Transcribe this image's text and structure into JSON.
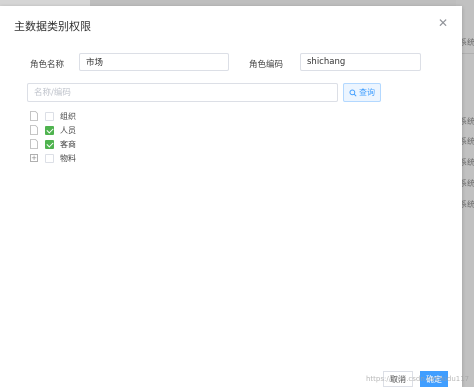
{
  "background": {
    "side_items": [
      "系统",
      "系统",
      "系统",
      "系统",
      "系统",
      "系统"
    ]
  },
  "dialog": {
    "title": "主数据类别权限",
    "close_icon": "close-icon"
  },
  "form": {
    "role_name_label": "角色名称",
    "role_name_value": "市场",
    "role_code_label": "角色编码",
    "role_code_value": "shichang"
  },
  "search": {
    "placeholder": "名称/编码",
    "button_label": "查询",
    "button_icon": "search-icon"
  },
  "tree": {
    "items": [
      {
        "label": "组织",
        "checked": false,
        "icon": "document-icon"
      },
      {
        "label": "人员",
        "checked": true,
        "icon": "document-icon"
      },
      {
        "label": "客商",
        "checked": true,
        "icon": "document-icon"
      },
      {
        "label": "物料",
        "checked": false,
        "icon": "expand-plus-icon"
      }
    ]
  },
  "footer": {
    "cancel_label": "取消",
    "ok_label": "确定"
  },
  "watermark": "https://blog.csdn.net/kidu117",
  "colors": {
    "primary": "#409eff",
    "check": "#4fb34f",
    "border": "#dcdfe6"
  }
}
